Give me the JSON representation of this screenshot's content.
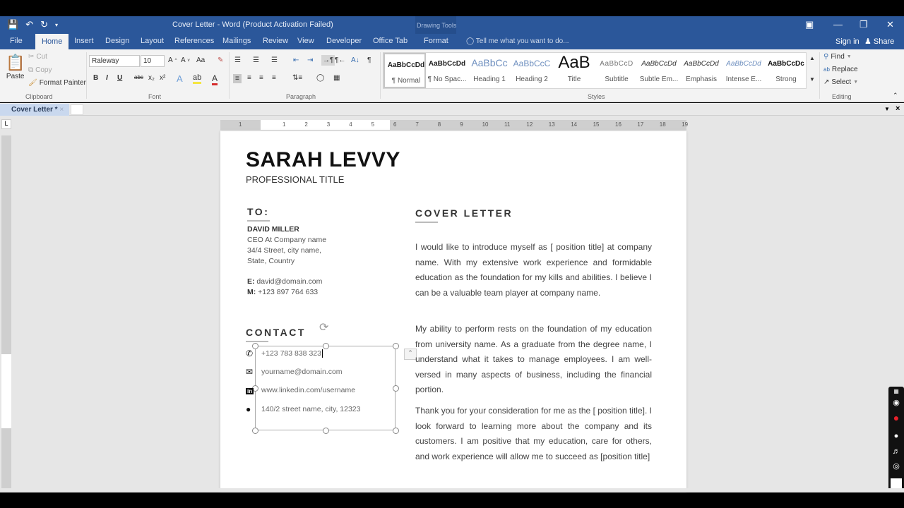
{
  "window": {
    "title": "Cover Letter - Word (Product Activation Failed)",
    "context_group": "Drawing Tools",
    "controls": [
      "ribbon-display-icon",
      "minimize-icon",
      "restore-icon",
      "close-icon"
    ]
  },
  "quick_access": [
    "save-icon",
    "undo-icon",
    "redo-icon",
    "customize-icon"
  ],
  "tabs": [
    {
      "label": "File",
      "active": false
    },
    {
      "label": "Home",
      "active": true
    },
    {
      "label": "Insert",
      "active": false
    },
    {
      "label": "Design",
      "active": false
    },
    {
      "label": "Layout",
      "active": false
    },
    {
      "label": "References",
      "active": false
    },
    {
      "label": "Mailings",
      "active": false
    },
    {
      "label": "Review",
      "active": false
    },
    {
      "label": "View",
      "active": false
    },
    {
      "label": "Developer",
      "active": false
    },
    {
      "label": "Office Tab",
      "active": false
    },
    {
      "label": "Format",
      "active": false
    }
  ],
  "tell_me": "Tell me what you want to do...",
  "sign_in": "Sign in",
  "share": "Share",
  "ribbon": {
    "clipboard": {
      "paste": "Paste",
      "cut": "Cut",
      "copy": "Copy",
      "format_painter": "Format Painter",
      "label": "Clipboard"
    },
    "font": {
      "name": "Raleway",
      "size": "10",
      "label": "Font",
      "bold": "B",
      "italic": "I",
      "underline": "U",
      "strike": "abc",
      "subscript": "x₂",
      "superscript": "x²",
      "change_case": "Aa"
    },
    "paragraph": {
      "label": "Paragraph"
    },
    "styles": {
      "label": "Styles",
      "items": [
        {
          "preview": "AaBbCcDd",
          "name": "¶ Normal",
          "selected": true
        },
        {
          "preview": "AaBbCcDd",
          "name": "¶ No Spac..."
        },
        {
          "preview": "AaBbCc",
          "name": "Heading 1"
        },
        {
          "preview": "AaBbCcC",
          "name": "Heading 2"
        },
        {
          "preview": "AaB",
          "name": "Title"
        },
        {
          "preview": "AaBbCcD",
          "name": "Subtitle"
        },
        {
          "preview": "AaBbCcDd",
          "name": "Subtle Em..."
        },
        {
          "preview": "AaBbCcDd",
          "name": "Emphasis"
        },
        {
          "preview": "AaBbCcDd",
          "name": "Intense E..."
        },
        {
          "preview": "AaBbCcDc",
          "name": "Strong"
        }
      ]
    },
    "editing": {
      "find": "Find",
      "replace": "Replace",
      "select": "Select",
      "label": "Editing"
    }
  },
  "doc_tab": {
    "label": "Cover Letter *"
  },
  "ruler": {
    "marks": [
      "1",
      "1",
      "2",
      "3",
      "4",
      "5",
      "6",
      "7",
      "8",
      "9",
      "10",
      "11",
      "12",
      "13",
      "14",
      "15",
      "16",
      "17",
      "18",
      "19"
    ]
  },
  "document": {
    "name": "SARAH LEVVY",
    "professional_title": "PROFESSIONAL TITLE",
    "to_heading": "TO:",
    "recipient": {
      "name": "DAVID MILLER",
      "line1": "CEO At Company name",
      "line2": "34/4 Street, city name,",
      "line3": "State, Country",
      "email_label": "E:",
      "email": "david@domain.com",
      "mobile_label": "M:",
      "mobile": "+123 897 764 633"
    },
    "contact_heading": "CONTACT",
    "contact": [
      {
        "icon": "phone-icon",
        "glyph": "✆",
        "text": "+123 783 838 323"
      },
      {
        "icon": "email-icon",
        "glyph": "✉",
        "text": "yourname@domain.com"
      },
      {
        "icon": "linkedin-icon",
        "glyph": "in",
        "text": "www.linkedin.com/username"
      },
      {
        "icon": "location-icon",
        "glyph": "●",
        "text": "140/2 street name, city, 12323"
      }
    ],
    "cover_heading": "COVER LETTER",
    "paragraphs": [
      "I would like to introduce myself as [ position title] at company name. With my extensive work experience and formidable education as the foundation for my kills and abilities. I believe I can be a valuable team player at company name.",
      "My ability to perform rests on the foundation of my education from university name. As a graduate from the degree name, I understand what it takes to manage employees. I am well-versed in many aspects of business, including the financial portion.",
      "Thank you for your consideration for me as the [ position title]. I look forward to learning more about the company and its customers. I am positive that my education, care for others, and work experience will allow me to succeed as [position title]"
    ]
  },
  "colors": {
    "word_blue": "#2b579a",
    "ribbon_bg": "#f3f3f3",
    "record_red": "#e8202a"
  }
}
